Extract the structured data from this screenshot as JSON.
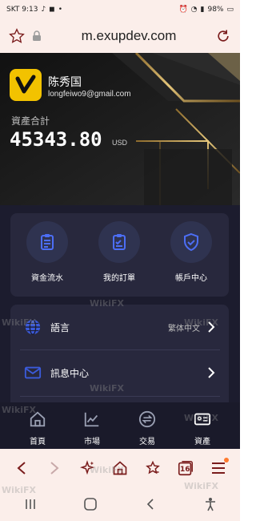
{
  "status_bar": {
    "carrier_time": "SKT 9:13",
    "battery": "98%"
  },
  "browser": {
    "url": "m.exupdev.com",
    "tabs_count": "16"
  },
  "header": {
    "user_name": "陈秀国",
    "email": "longfeiwo9@gmail.com",
    "total_label": "資產合計",
    "total_value": "45343.80",
    "total_unit": "USD"
  },
  "quick_actions": [
    {
      "label": "資金流水",
      "icon": "ledger-icon"
    },
    {
      "label": "我的訂單",
      "icon": "orders-icon"
    },
    {
      "label": "帳戶中心",
      "icon": "shield-icon"
    }
  ],
  "settings": [
    {
      "label": "語言",
      "value": "繁体中文",
      "icon": "globe-icon"
    },
    {
      "label": "訊息中心",
      "value": "",
      "icon": "mail-icon"
    }
  ],
  "tabs": [
    {
      "label": "首頁",
      "icon": "home-icon"
    },
    {
      "label": "市場",
      "icon": "chart-icon"
    },
    {
      "label": "交易",
      "icon": "exchange-icon"
    },
    {
      "label": "資產",
      "icon": "wallet-icon"
    }
  ],
  "watermark_text": "WikiFX",
  "colors": {
    "accent_blue": "#3b5bdb",
    "avatar_yellow": "#f2c200",
    "gold": "#c9a45a",
    "panel_bg": "#28283d",
    "app_bg": "#1c1c2e",
    "browser_bg": "#fbeeea"
  }
}
